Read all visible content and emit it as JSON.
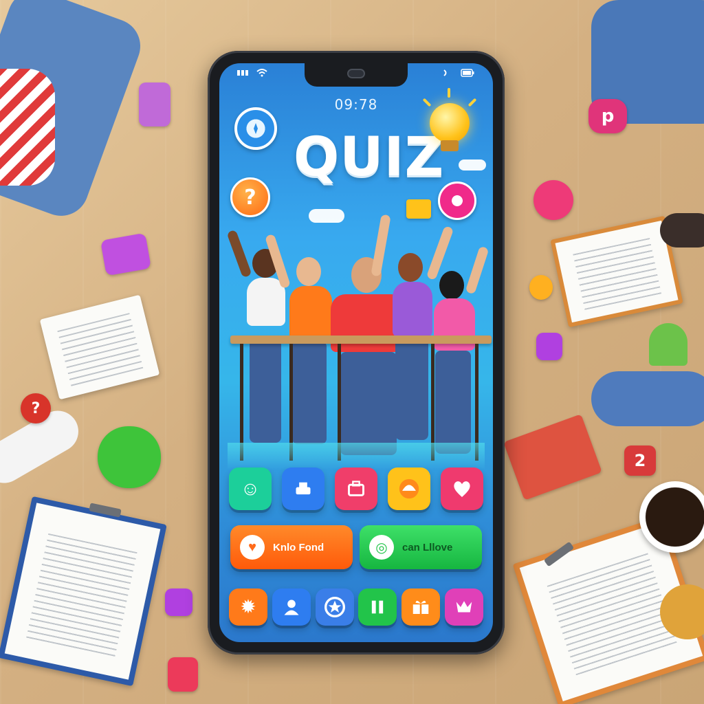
{
  "status_bar": {
    "time": "09:78"
  },
  "app": {
    "title": "QUIZ"
  },
  "bubbles": {
    "question_mark": "?"
  },
  "colors": {
    "orange": "#ff6a1a",
    "green": "#22c44a",
    "pink": "#f0407a",
    "blue": "#2e6fe6",
    "teal": "#18c9a0",
    "yellow": "#ffc21a",
    "purple": "#b44de0"
  },
  "top_buttons": [
    {
      "icon": "chat-face-icon",
      "color": "#1ccf9a"
    },
    {
      "icon": "printer-icon",
      "color": "#2e7df0"
    },
    {
      "icon": "briefcase-icon",
      "color": "#f03e6a"
    },
    {
      "icon": "dome-icon",
      "color": "#ffc21a"
    },
    {
      "icon": "heart-icon",
      "color": "#ef3a6e"
    }
  ],
  "pills": [
    {
      "label": "Knlo Fond",
      "icon": "heart-icon",
      "color": "#ff6a1a"
    },
    {
      "label": "can Lllove",
      "icon": "chat-icon",
      "color": "#22c44a"
    }
  ],
  "bottom_buttons": [
    {
      "icon": "sun-icon",
      "color": "#ff7a1a"
    },
    {
      "icon": "person-icon",
      "color": "#2e7df0"
    },
    {
      "icon": "star-badge-icon",
      "color": "#3a7ee8"
    },
    {
      "icon": "pause-icon",
      "color": "#22c44a"
    },
    {
      "icon": "gift-icon",
      "color": "#ff8c1a"
    },
    {
      "icon": "crown-icon",
      "color": "#e040b8"
    }
  ]
}
